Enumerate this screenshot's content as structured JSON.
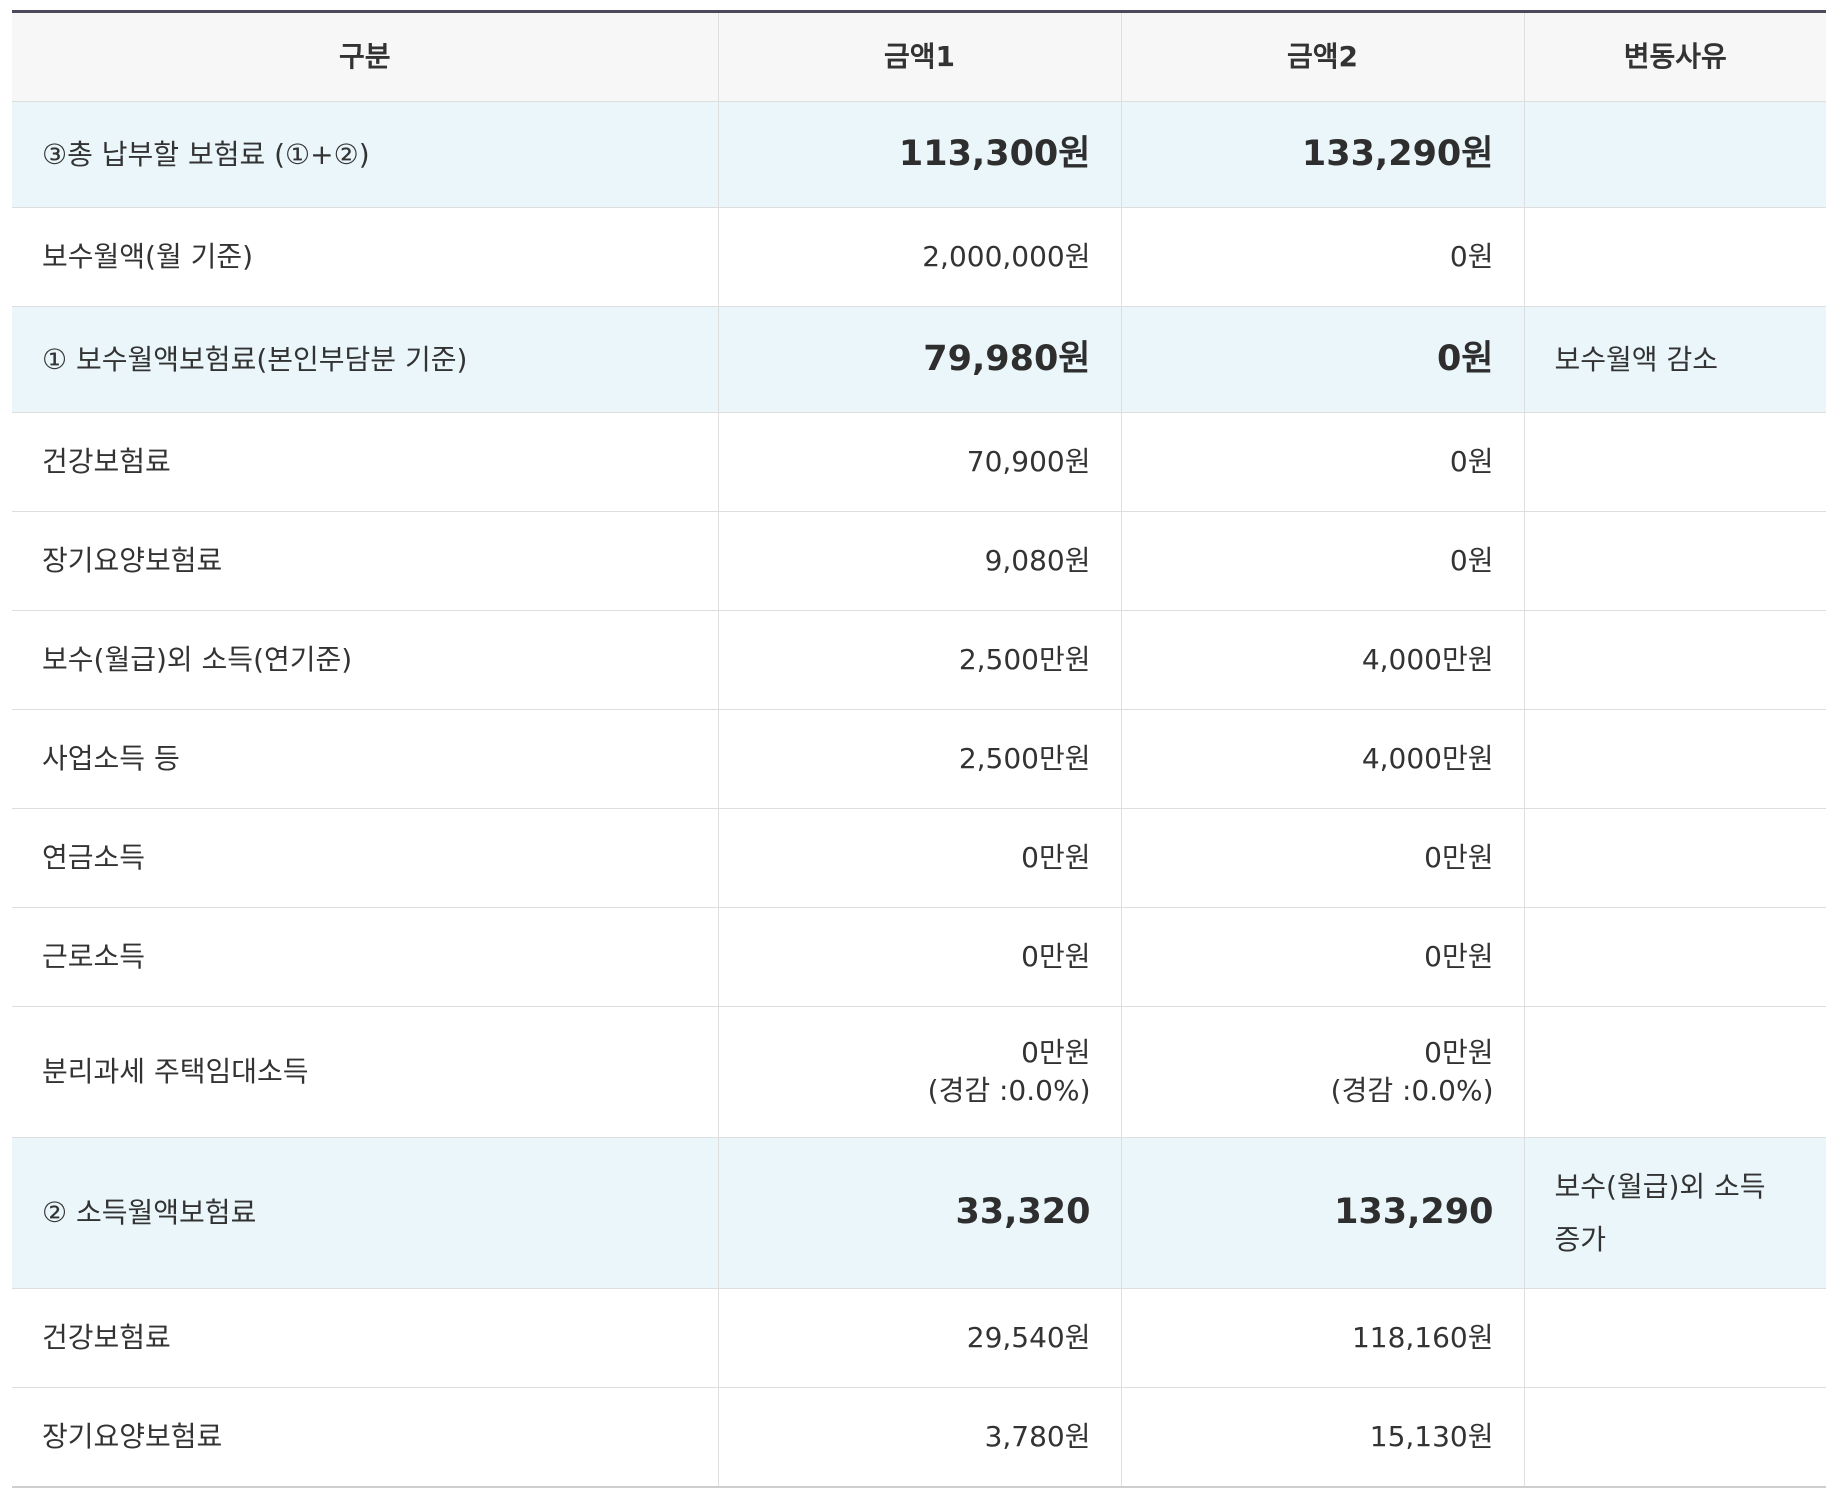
{
  "table": {
    "headers": [
      "구분",
      "금액1",
      "금액2",
      "변동사유"
    ],
    "rows": [
      {
        "label": "③총 납부할 보험료 (①+②)",
        "amount1": "113,300원",
        "amount2": "133,290원",
        "reason": "",
        "highlight": true
      },
      {
        "label": "보수월액(월 기준)",
        "amount1": "2,000,000원",
        "amount2": "0원",
        "reason": "",
        "highlight": false
      },
      {
        "label": "① 보수월액보험료(본인부담분 기준)",
        "amount1": "79,980원",
        "amount2": "0원",
        "reason": "보수월액 감소",
        "highlight": true
      },
      {
        "label": "건강보험료",
        "amount1": "70,900원",
        "amount2": "0원",
        "reason": "",
        "highlight": false
      },
      {
        "label": "장기요양보험료",
        "amount1": "9,080원",
        "amount2": "0원",
        "reason": "",
        "highlight": false
      },
      {
        "label": "보수(월급)외 소득(연기준)",
        "amount1": "2,500만원",
        "amount2": "4,000만원",
        "reason": "",
        "highlight": false
      },
      {
        "label": "사업소득 등",
        "amount1": "2,500만원",
        "amount2": "4,000만원",
        "reason": "",
        "highlight": false
      },
      {
        "label": "연금소득",
        "amount1": "0만원",
        "amount2": "0만원",
        "reason": "",
        "highlight": false
      },
      {
        "label": "근로소득",
        "amount1": "0만원",
        "amount2": "0만원",
        "reason": "",
        "highlight": false
      },
      {
        "label": "분리과세 주택임대소득",
        "amount1": "0만원",
        "amount1_sub": "(경감 :0.0%)",
        "amount2": "0만원",
        "amount2_sub": "(경감 :0.0%)",
        "reason": "",
        "highlight": false
      },
      {
        "label": "② 소득월액보험료",
        "amount1": "33,320",
        "amount2": "133,290",
        "reason": "보수(월급)외 소득 증가",
        "highlight": true
      },
      {
        "label": "건강보험료",
        "amount1": "29,540원",
        "amount2": "118,160원",
        "reason": "",
        "highlight": false
      },
      {
        "label": "장기요양보험료",
        "amount1": "3,780원",
        "amount2": "15,130원",
        "reason": "",
        "highlight": false
      }
    ]
  }
}
